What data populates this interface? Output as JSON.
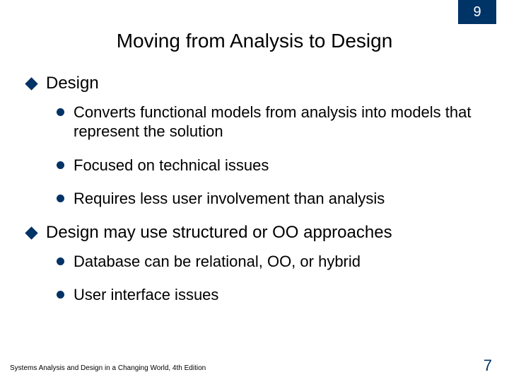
{
  "chapter": "9",
  "title": "Moving from Analysis to Design",
  "items": {
    "h1": "Design",
    "b1": "Converts functional models from analysis into models that represent the solution",
    "b2": "Focused on technical issues",
    "b3": "Requires less user involvement than analysis",
    "h2": "Design may use structured or OO approaches",
    "b4": "Database can be relational, OO, or hybrid",
    "b5": "User interface issues"
  },
  "footer": "Systems Analysis and Design in a Changing World, 4th Edition",
  "page": "7"
}
